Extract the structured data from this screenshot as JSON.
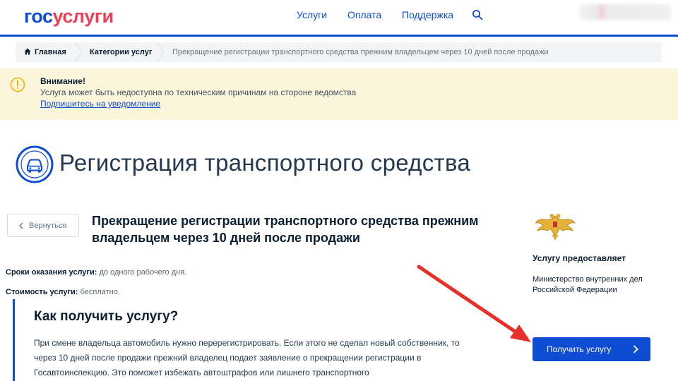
{
  "header": {
    "logo_part1": "гос",
    "logo_part2": "услуги",
    "nav": [
      "Услуги",
      "Оплата",
      "Поддержка"
    ]
  },
  "breadcrumb": {
    "home": "Главная",
    "category": "Категории услуг",
    "current": "Прекращение регистрации транспортного средства прежним владельцем через 10 дней после продажи"
  },
  "warning": {
    "title": "Внимание!",
    "text": "Услуга может быть недоступна по техническим причинам на стороне ведомства",
    "link": "Подпишитесь на уведомление"
  },
  "page": {
    "title": "Регистрация транспортного средства",
    "back_label": "Вернуться",
    "service_title": "Прекращение регистрации транспортного средства прежним владельцем через 10 дней после продажи",
    "term_label": "Сроки оказания услуги:",
    "term_value": "до одного рабочего дня.",
    "cost_label": "Стоимость услуги:",
    "cost_value": "бесплатно.",
    "how_title": "Как получить услугу?",
    "how_text": "При смене владельца автомобиль нужно перерегистрировать. Если этого не сделал новый собственник, то через 10 дней после продажи прежний владелец подает заявление о прекращении регистрации в Госавтоинспекцию. Это поможет избежать автоштрафов или лишнего транспортного"
  },
  "provider": {
    "heading": "Услугу предоставляет",
    "name": "Министерство внутренних дел Российской Федерации"
  },
  "actions": {
    "get_service": "Получить услугу"
  },
  "colors": {
    "brand_blue": "#0d4cd3",
    "brand_red": "#ee3f58",
    "warning_bg": "#fbf5db",
    "annotation_arrow": "#e8302b"
  },
  "icons": [
    "search-icon",
    "home-icon",
    "warning-icon",
    "car-icon",
    "chevron-left-icon",
    "chevron-right-icon",
    "emblem-icon"
  ]
}
